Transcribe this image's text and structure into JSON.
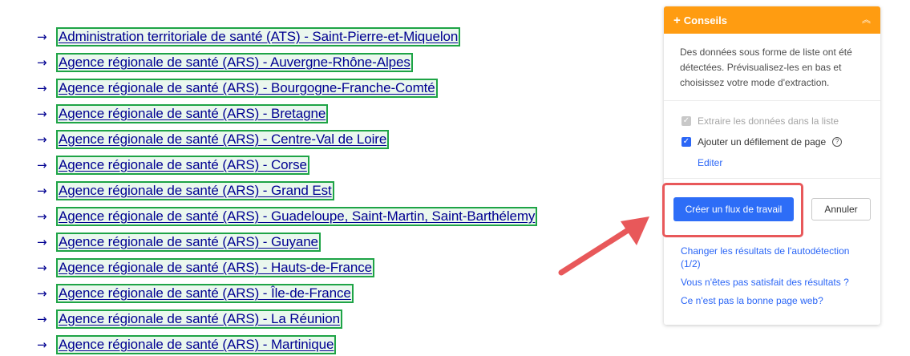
{
  "links": [
    "Administration territoriale de santé (ATS) - Saint-Pierre-et-Miquelon",
    "Agence régionale de santé (ARS) - Auvergne-Rhône-Alpes",
    "Agence régionale de santé (ARS) - Bourgogne-Franche-Comté",
    "Agence régionale de santé (ARS) - Bretagne",
    "Agence régionale de santé (ARS) - Centre-Val de Loire",
    "Agence régionale de santé (ARS) - Corse",
    "Agence régionale de santé (ARS) - Grand Est",
    "Agence régionale de santé (ARS) - Guadeloupe, Saint-Martin, Saint-Barthélemy",
    "Agence régionale de santé (ARS) - Guyane",
    "Agence régionale de santé (ARS) - Hauts-de-France",
    "Agence régionale de santé (ARS) - Île-de-France",
    "Agence régionale de santé (ARS) - La Réunion",
    "Agence régionale de santé (ARS) - Martinique"
  ],
  "panel": {
    "title": "Conseils",
    "description": "Des données sous forme de liste ont été détectées. Prévisualisez-les en bas et choisissez votre mode d'extraction.",
    "option_extract": "Extraire les données dans la liste",
    "option_scroll": "Ajouter un défilement de page",
    "edit_label": "Editer",
    "create_button": "Créer un flux de travail",
    "cancel_button": "Annuler",
    "link_change_results": "Changer les résultats de l'autodétection (1/2)",
    "link_not_satisfied": "Vous n'êtes pas satisfait des résultats ?",
    "link_wrong_page": "Ce n'est pas la bonne page web?"
  },
  "colors": {
    "link": "#000091",
    "link_box_border": "#1ea446",
    "panel_header": "#ff9c11",
    "primary_button": "#2d6df7",
    "annotation": "#e8585a"
  },
  "icons": {
    "list_bullet": "→",
    "header_plus": "+",
    "collapse": "︽",
    "check": "✓",
    "help": "?"
  }
}
